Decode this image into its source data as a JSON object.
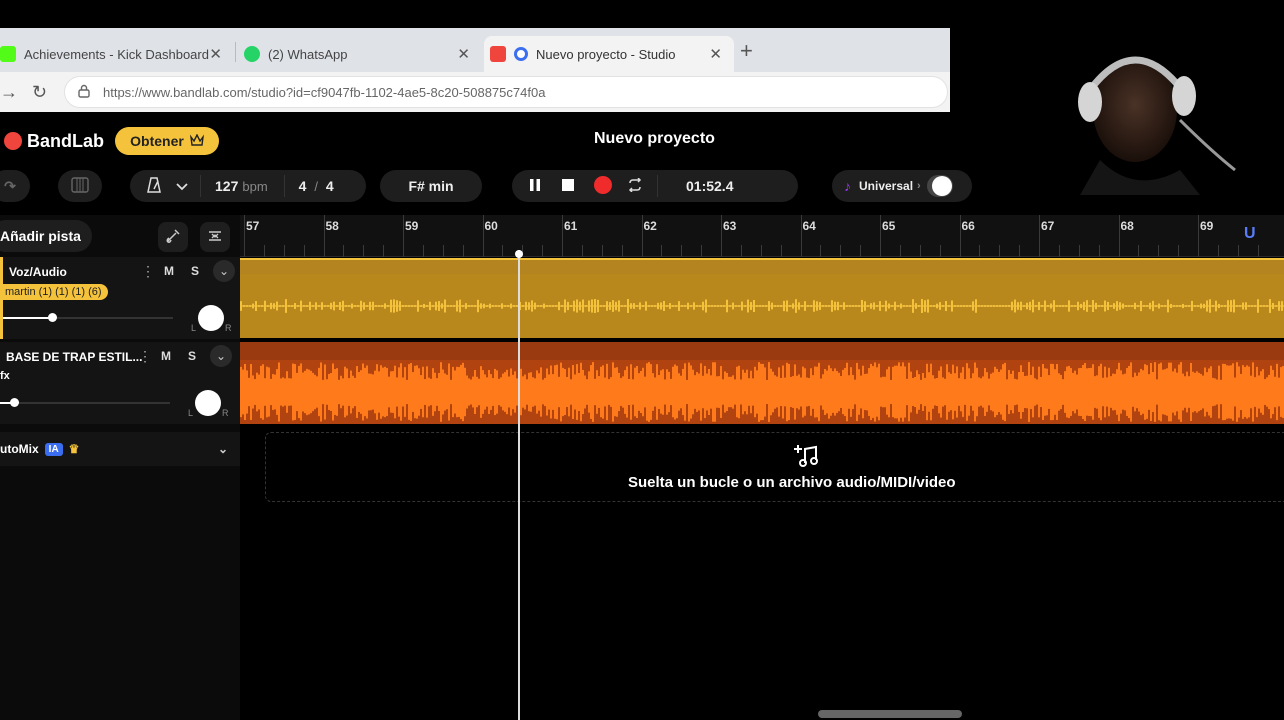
{
  "browser": {
    "tabs": [
      {
        "title": "Achievements - Kick Dashboard",
        "icon": "kick-icon",
        "color": "#53fc18"
      },
      {
        "title": "(2) WhatsApp",
        "icon": "whatsapp-icon",
        "color": "#25d366"
      },
      {
        "title": "Nuevo proyecto - Studio",
        "icon": "bandlab-icon",
        "color": "#f0453c",
        "active": true
      }
    ],
    "close_glyph": "✕",
    "new_tab_glyph": "+",
    "url": "https://www.bandlab.com/studio?id=cf9047fb-1102-4ae5-8c20-508875c74f0a"
  },
  "app": {
    "logo_text": "BandLab",
    "get_button": "Obtener",
    "project_title": "Nuevo proyecto"
  },
  "toolbar": {
    "tempo_value": "127",
    "tempo_unit": "bpm",
    "time_sig_num": "4",
    "time_sig_sep": "/",
    "time_sig_den": "4",
    "key": "F# min",
    "time": "01:52.4",
    "ai_label": "Universal"
  },
  "left_panel": {
    "add_track": "Añadir pista",
    "tracks": [
      {
        "name": "Voz/Audio",
        "clip": "martin (1) (1) (1) (6)",
        "mute": "M",
        "solo": "S",
        "volume": 0.22,
        "pan_l": "L",
        "pan_r": "R"
      },
      {
        "name": "BASE DE TRAP ESTIL...",
        "fx": "fx",
        "mute": "M",
        "solo": "S",
        "volume": 0.06,
        "pan_l": "L",
        "pan_r": "R"
      }
    ],
    "automix": {
      "label": "utoMix",
      "badge": "IA"
    }
  },
  "timeline": {
    "bars": [
      "57",
      "58",
      "59",
      "60",
      "61",
      "62",
      "63",
      "64",
      "65",
      "66",
      "67",
      "68",
      "69"
    ],
    "drop_text": "Suelta un bucle o un archivo audio/MIDI/video"
  },
  "colors": {
    "accent_yellow": "#f5c33b",
    "record_red": "#ef2b2b",
    "vocal_lane": "#b8881d",
    "beat_lane": "#b0430f",
    "beat_wave": "#ff7a1a",
    "vocal_wave": "#f5c33b"
  }
}
